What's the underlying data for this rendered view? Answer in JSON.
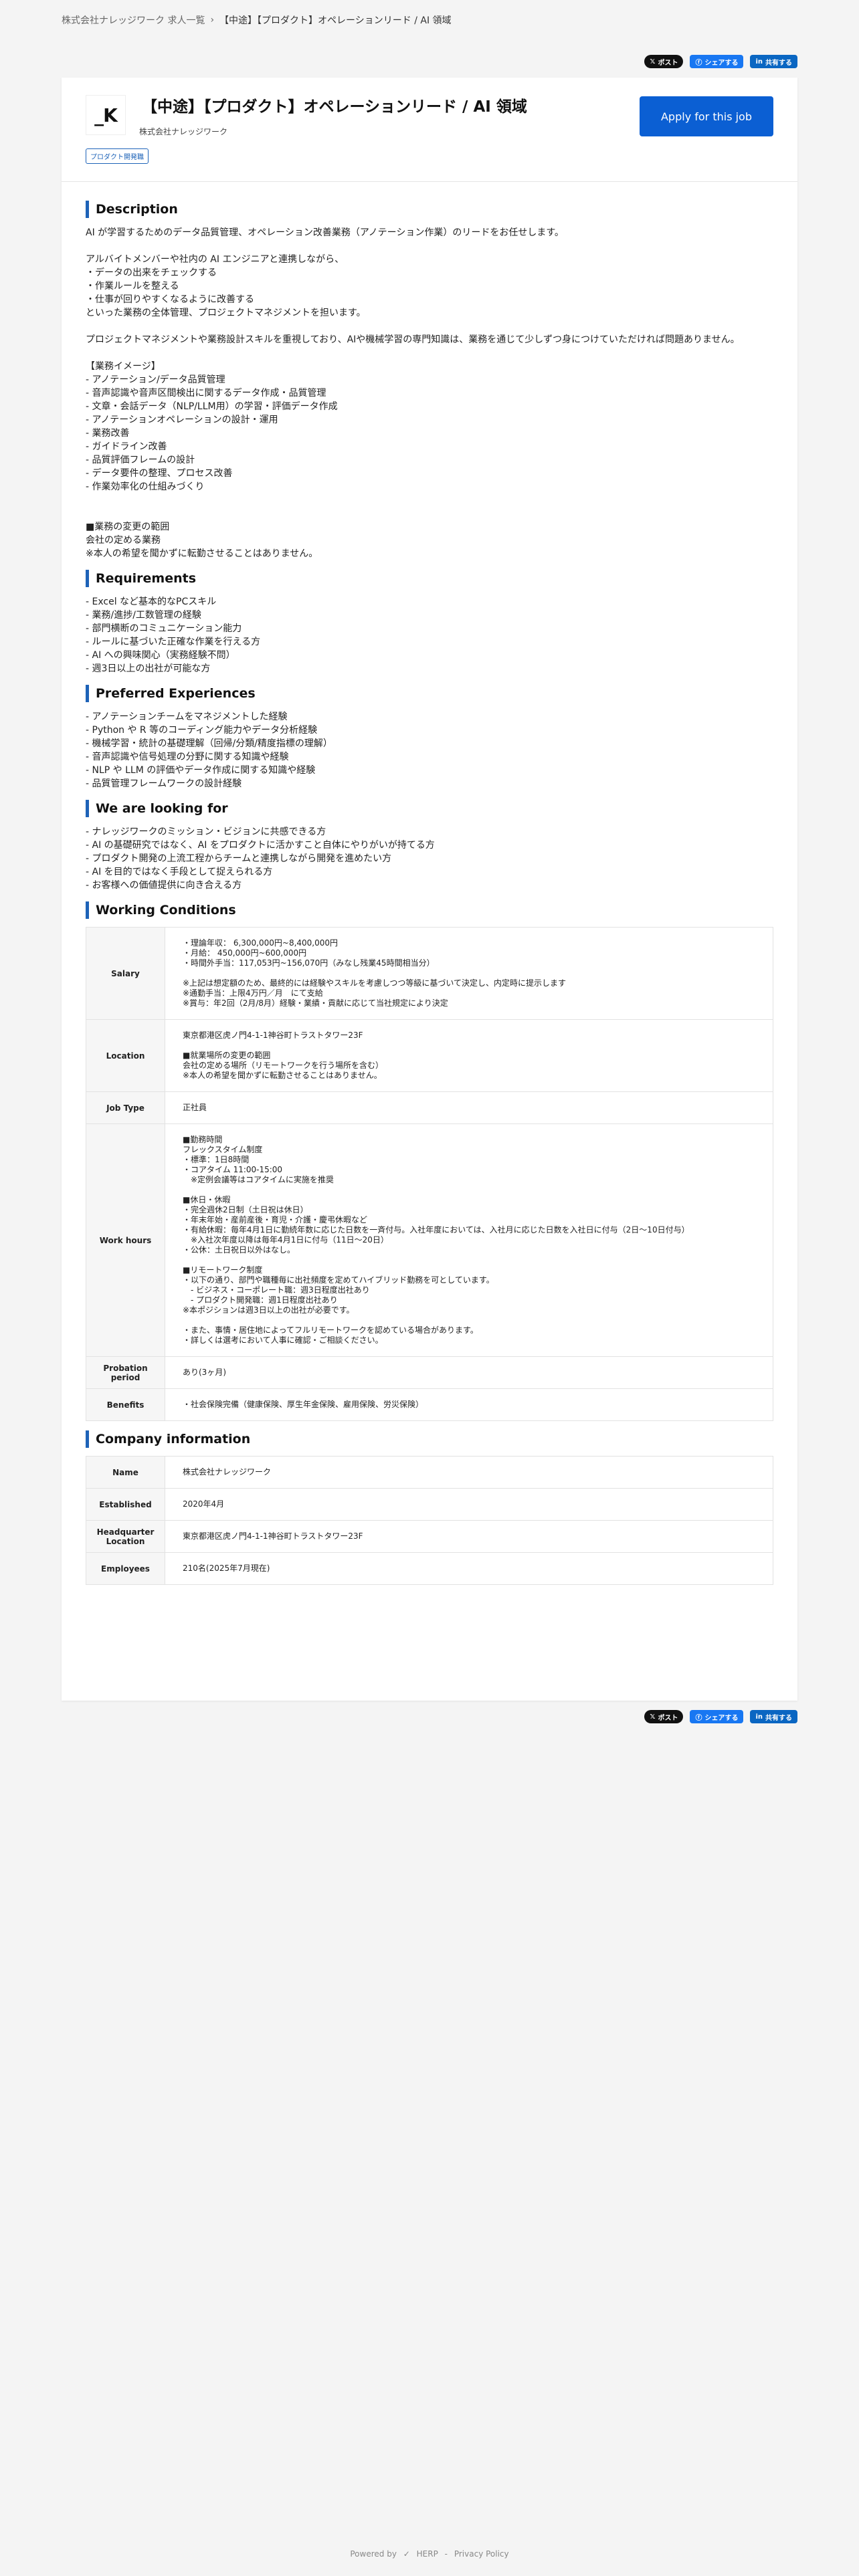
{
  "breadcrumb": {
    "parent": "株式会社ナレッジワーク 求人一覧",
    "separator": "›",
    "current": "【中途】【プロダクト】オペレーションリード / AI 領域"
  },
  "share": {
    "x_label": "ポスト",
    "facebook_label": "シェアする",
    "linkedin_label": "共有する"
  },
  "job": {
    "logo_text": "_K",
    "title": "【中途】【プロダクト】オペレーションリード / AI 領域",
    "company": "株式会社ナレッジワーク",
    "tag": "プロダクト開発職",
    "apply_label": "Apply for this job"
  },
  "sections": {
    "description": {
      "heading": "Description",
      "body": "AI が学習するためのデータ品質管理、オペレーション改善業務（アノテーション作業）のリードをお任せします。\n\nアルバイトメンバーや社内の AI エンジニアと連携しながら、\n・データの出来をチェックする\n・作業ルールを整える\n・仕事が回りやすくなるように改善する\nといった業務の全体管理、プロジェクトマネジメントを担います。\n\nプロジェクトマネジメントや業務設計スキルを重視しており、AIや機械学習の専門知識は、業務を通じて少しずつ身につけていただければ問題ありません。\n\n【業務イメージ】\n- アノテーション/データ品質管理\n - 音声認識や音声区間検出に関するデータ作成・品質管理\n - 文章・会話データ（NLP/LLM用）の学習・評価データ作成\n - アノテーションオペレーションの設計・運用\n- 業務改善\n - ガイドライン改善\n - 品質評価フレームの設計\n - データ要件の整理、プロセス改善\n - 作業効率化の仕組みづくり\n\n\n■業務の変更の範囲\n会社の定める業務\n※本人の希望を聞かずに転勤させることはありません。"
    },
    "requirements": {
      "heading": "Requirements",
      "body": "- Excel など基本的なPCスキル\n- 業務/進捗/工数管理の経験\n- 部門横断のコミュニケーション能力\n- ルールに基づいた正確な作業を行える方\n- AI への興味関心（実務経験不問）\n- 週3日以上の出社が可能な方"
    },
    "preferred": {
      "heading": "Preferred Experiences",
      "body": "- アノテーションチームをマネジメントした経験\n- Python や R 等のコーディング能力やデータ分析経験\n- 機械学習・統計の基礎理解（回帰/分類/精度指標の理解）\n- 音声認識や信号処理の分野に関する知識や経験\n- NLP や LLM の評価やデータ作成に関する知識や経験\n- 品質管理フレームワークの設計経験"
    },
    "looking_for": {
      "heading": "We are looking for",
      "body": "- ナレッジワークのミッション・ビジョンに共感できる方\n- AI の基礎研究ではなく、AI をプロダクトに活かすこと自体にやりがいが持てる方\n- プロダクト開発の上流工程からチームと連携しながら開発を進めたい方\n- AI を目的ではなく手段として捉えられる方\n- お客様への価値提供に向き合える方"
    },
    "working_conditions": {
      "heading": "Working Conditions",
      "rows": [
        {
          "label": "Salary",
          "value": "・理論年収：  6,300,000円~8,400,000円\n・月給：  450,000円~600,000円\n・時間外手当：117,053円~156,070円（みなし残業45時間相当分）\n\n※上記は想定額のため、最終的には経験やスキルを考慮しつつ等級に基づいて決定し、内定時に提示します\n※通勤手当：上限4万円／月　にて支給\n※賞与：年2回（2月/8月）経験・業績・貢献に応じて当社規定により決定"
        },
        {
          "label": "Location",
          "value": "東京都港区虎ノ門4-1-1神谷町トラストタワー23F\n\n■就業場所の変更の範囲\n会社の定める場所（リモートワークを行う場所を含む）\n※本人の希望を聞かずに転勤させることはありません。"
        },
        {
          "label": "Job Type",
          "value": "正社員"
        },
        {
          "label": "Work hours",
          "value": "■勤務時間\nフレックスタイム制度\n・標準：1日8時間\n・コアタイム 11:00-15:00\n　※定例会議等はコアタイムに実施を推奨\n\n■休日・休暇\n・完全週休2日制（土日祝は休日）\n・年末年始・産前産後・育児・介護・慶弔休暇など\n・有給休暇：毎年4月1日に勤続年数に応じた日数を一斉付与。入社年度においては、入社月に応じた日数を入社日に付与（2日〜10日付与）\n　※入社次年度以降は毎年4月1日に付与（11日〜20日）\n・公休：土日祝日以外はなし。\n\n■リモートワーク制度\n・以下の通り、部門や職種毎に出社頻度を定めてハイブリッド勤務を可としています。\n　- ビジネス・コーポレート職：週3日程度出社あり\n　- プロダクト開発職：週1日程度出社あり\n※本ポジションは週3日以上の出社が必要です。\n\n・また、事情・居住地によってフルリモートワークを認めている場合があります。\n・詳しくは選考において人事に確認・ご相談ください。"
        },
        {
          "label": "Probation period",
          "value": "あり(3ヶ月)"
        },
        {
          "label": "Benefits",
          "value": "・社会保険完備（健康保険、厚生年金保険、雇用保険、労災保険）"
        }
      ]
    },
    "company_info": {
      "heading": "Company information",
      "rows": [
        {
          "label": "Name",
          "value": "株式会社ナレッジワーク"
        },
        {
          "label": "Established",
          "value": "2020年4月"
        },
        {
          "label": "Headquarter Location",
          "value": "東京都港区虎ノ門4-1-1神谷町トラストタワー23F"
        },
        {
          "label": "Employees",
          "value": "210名(2025年7月現在)"
        }
      ]
    }
  },
  "footer": {
    "powered_by": "Powered by",
    "brand": "HERP",
    "separator": "-",
    "privacy": "Privacy Policy"
  }
}
